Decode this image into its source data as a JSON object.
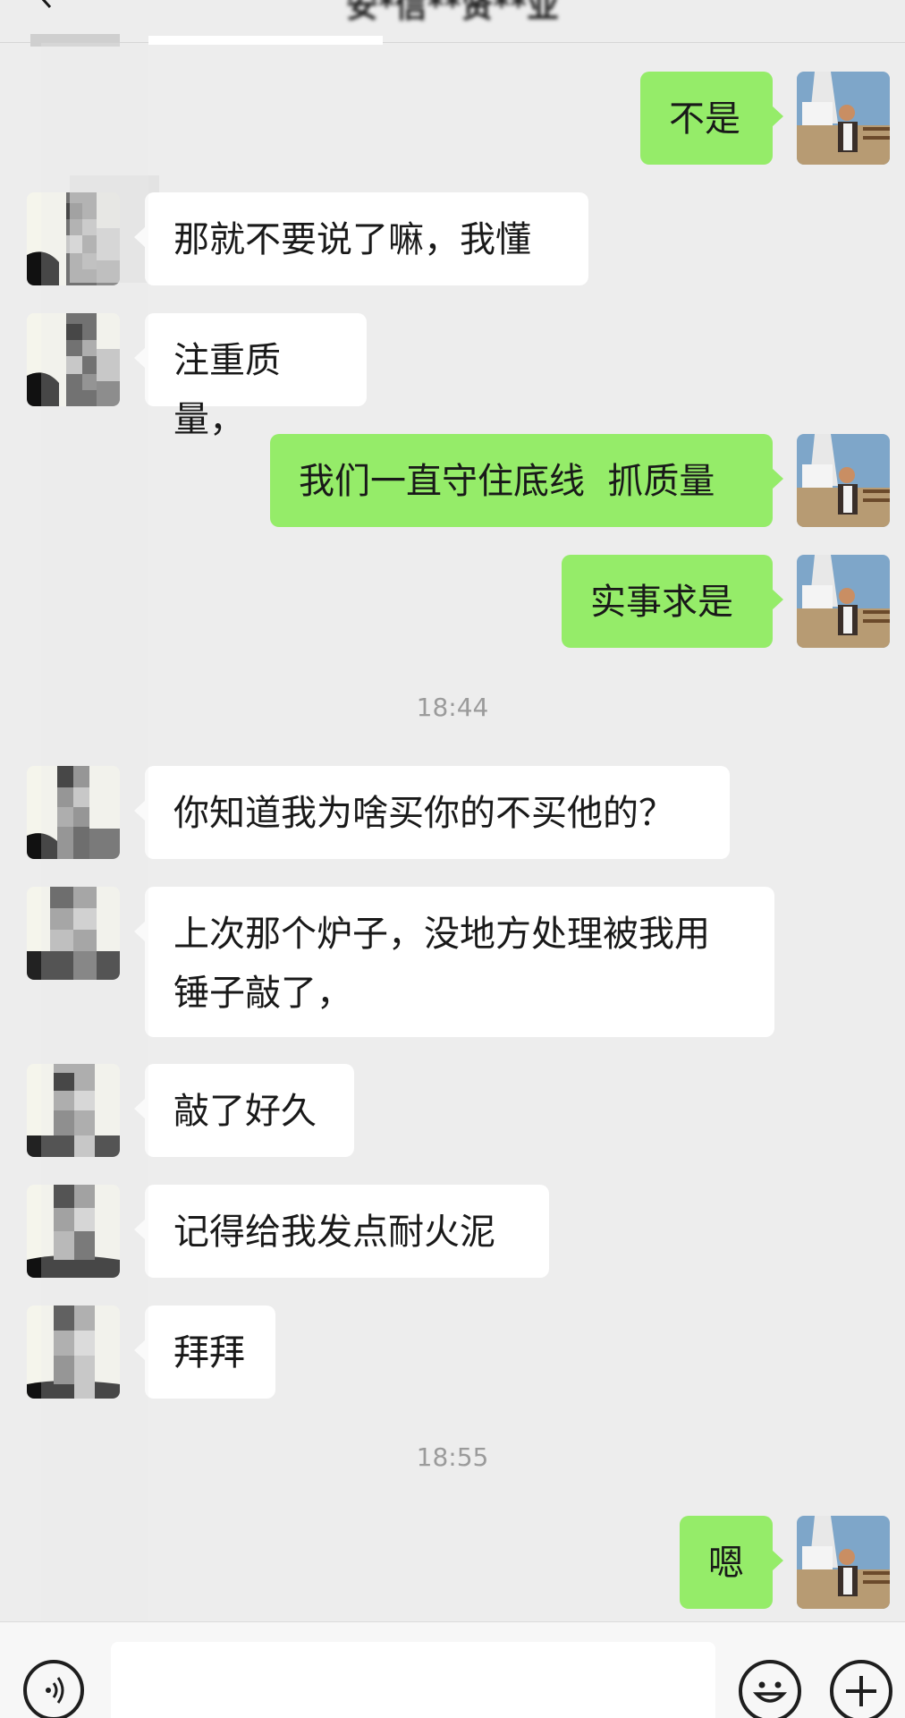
{
  "header": {
    "title": "安*信**贤**业"
  },
  "messages": [
    {
      "side": "right",
      "text": "不是"
    },
    {
      "side": "left",
      "text": "那就不要说了嘛，我懂"
    },
    {
      "side": "left",
      "text": "注重质量，"
    },
    {
      "side": "right",
      "text": "我们一直守住底线  抓质量"
    },
    {
      "side": "right",
      "text": "实事求是"
    },
    {
      "side": "left",
      "text": "你知道我为啥买你的不买他的？"
    },
    {
      "side": "left",
      "text_line1": "上次那个炉子，没地方处理被我用",
      "text_line2": "锤子敲了，"
    },
    {
      "side": "left",
      "text": "敲了好久"
    },
    {
      "side": "left",
      "text": "记得给我发点耐火泥"
    },
    {
      "side": "left",
      "text": "拜拜"
    },
    {
      "side": "right",
      "text": "嗯"
    }
  ],
  "timestamps": [
    "18:44",
    "18:55"
  ],
  "input": {
    "value": "",
    "placeholder": ""
  },
  "icons": {
    "back": "back-arrow-icon",
    "voice": "voice-icon",
    "emoji": "emoji-icon",
    "plus": "plus-icon"
  },
  "colors": {
    "background": "#ededed",
    "outgoing_bubble": "#95ec69",
    "incoming_bubble": "#ffffff",
    "timestamp_text": "#9b9b9b"
  }
}
